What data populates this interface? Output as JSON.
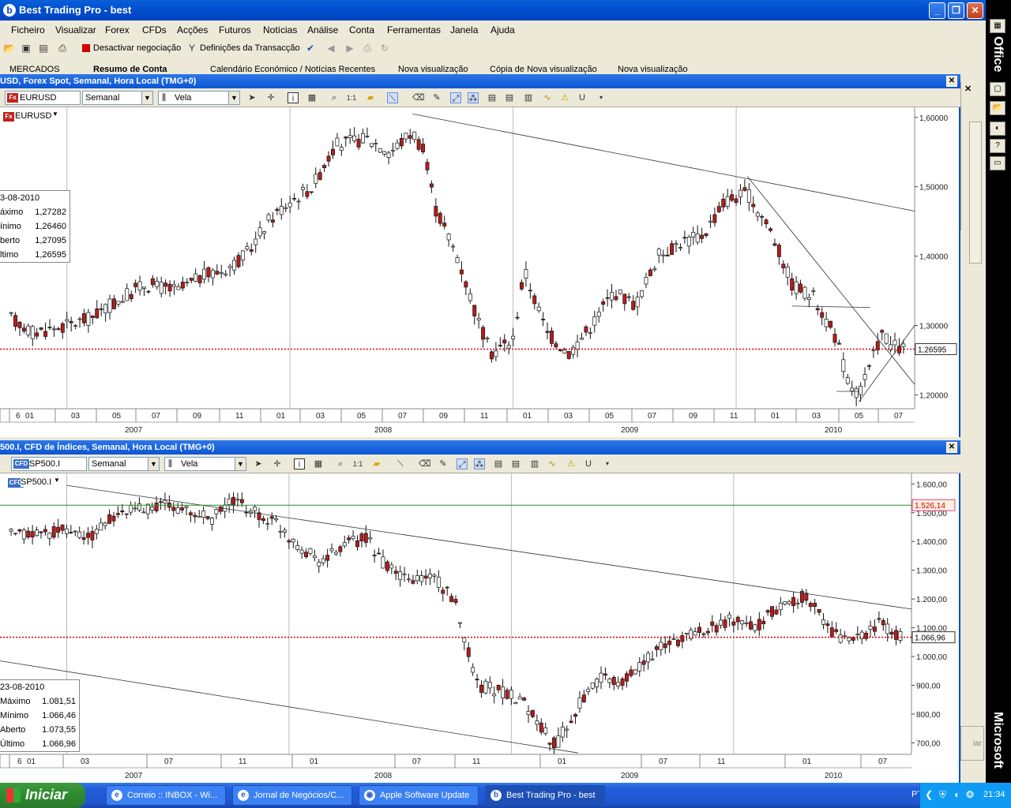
{
  "app": {
    "title": "Best Trading Pro - best"
  },
  "menu": [
    "Ficheiro",
    "Visualizar",
    "Forex",
    "CFDs",
    "Acções",
    "Futuros",
    "Notícias",
    "Análise",
    "Conta",
    "Ferramentas",
    "Janela",
    "Ajuda"
  ],
  "toolbar": {
    "deactivate_label": "Desactivar negociação",
    "settings_label": "Definições da Transacção"
  },
  "tabs": [
    "MERCADOS",
    "Resumo de Conta",
    "Calendário Económico / Notícias Recentes",
    "Nova visualização",
    "Cópia de Nova visualização",
    "Nova visualização"
  ],
  "office": {
    "top_label": "Office",
    "bottom_label": "Microsoft"
  },
  "chart1": {
    "window_title": "USD, Forex Spot, Semanal, Hora Local (TMG+0)",
    "symbol": "EURUSD",
    "symbol_badge": "Fx",
    "period": "Semanal",
    "chart_type": "Vela",
    "legend_label": "EURUSD",
    "info": {
      "date": "3-08-2010",
      "rows": [
        {
          "k": "áximo",
          "v": "1,27282"
        },
        {
          "k": "ínimo",
          "v": "1,26460"
        },
        {
          "k": "berto",
          "v": "1,27095"
        },
        {
          "k": "ltimo",
          "v": "1,26595"
        }
      ]
    },
    "current_price": "1,26595"
  },
  "chart2": {
    "window_title": "500.I, CFD de Índices, Semanal, Hora Local (TMG+0)",
    "symbol": "SP500.I",
    "symbol_badge": "CFD",
    "period": "Semanal",
    "chart_type": "Vela",
    "legend_label": "SP500.I",
    "info": {
      "date": "23-08-2010",
      "rows": [
        {
          "k": "Máximo",
          "v": "1.081,51"
        },
        {
          "k": "Mínimo",
          "v": "1.066,46"
        },
        {
          "k": "Aberto",
          "v": "1.073,55"
        },
        {
          "k": "Último",
          "v": "1.066,96"
        }
      ]
    },
    "current_price": "1.066,96",
    "level_price": "1.526,14",
    "partial_button": "iar"
  },
  "chart_data": [
    {
      "type": "candlestick",
      "series": [
        {
          "name": "EURUSD",
          "values": []
        }
      ],
      "ylim": [
        1.18,
        1.61
      ],
      "y_ticks": [
        "1,60000",
        "1,50000",
        "1,40000",
        "1,30000",
        "1,20000"
      ],
      "x_month_ticks": [
        "6",
        "01",
        "03",
        "05",
        "07",
        "09",
        "11",
        "01",
        "03",
        "05",
        "07",
        "09",
        "11",
        "01",
        "03",
        "05",
        "07",
        "09",
        "11",
        "01",
        "03",
        "05",
        "07"
      ],
      "x_year_ticks": [
        "2007",
        "2008",
        "2009",
        "2010"
      ],
      "x_range": [
        "2006-09",
        "2010-09"
      ],
      "close_path": [
        [
          2006.75,
          1.31
        ],
        [
          2006.85,
          1.29
        ],
        [
          2007.0,
          1.3
        ],
        [
          2007.1,
          1.31
        ],
        [
          2007.2,
          1.33
        ],
        [
          2007.35,
          1.36
        ],
        [
          2007.5,
          1.35
        ],
        [
          2007.6,
          1.37
        ],
        [
          2007.7,
          1.38
        ],
        [
          2007.8,
          1.4
        ],
        [
          2007.9,
          1.45
        ],
        [
          2008.0,
          1.48
        ],
        [
          2008.1,
          1.5
        ],
        [
          2008.2,
          1.56
        ],
        [
          2008.35,
          1.57
        ],
        [
          2008.45,
          1.55
        ],
        [
          2008.55,
          1.58
        ],
        [
          2008.6,
          1.55
        ],
        [
          2008.65,
          1.47
        ],
        [
          2008.75,
          1.4
        ],
        [
          2008.85,
          1.3
        ],
        [
          2008.9,
          1.26
        ],
        [
          2009.0,
          1.28
        ],
        [
          2009.05,
          1.38
        ],
        [
          2009.15,
          1.29
        ],
        [
          2009.25,
          1.26
        ],
        [
          2009.35,
          1.3
        ],
        [
          2009.45,
          1.35
        ],
        [
          2009.55,
          1.33
        ],
        [
          2009.65,
          1.4
        ],
        [
          2009.75,
          1.42
        ],
        [
          2009.85,
          1.43
        ],
        [
          2009.95,
          1.48
        ],
        [
          2010.05,
          1.49
        ],
        [
          2010.15,
          1.44
        ],
        [
          2010.25,
          1.36
        ],
        [
          2010.35,
          1.34
        ],
        [
          2010.45,
          1.28
        ],
        [
          2010.5,
          1.22
        ],
        [
          2010.55,
          1.2
        ],
        [
          2010.6,
          1.24
        ],
        [
          2010.65,
          1.29
        ],
        [
          2010.7,
          1.27
        ],
        [
          2010.75,
          1.26595
        ]
      ],
      "last_close": 1.26595
    },
    {
      "type": "candlestick",
      "series": [
        {
          "name": "SP500.I",
          "values": []
        }
      ],
      "ylim": [
        660,
        1620
      ],
      "y_ticks": [
        "1.600,00",
        "1.500,00",
        "1.400,00",
        "1.300,00",
        "1.200,00",
        "1.100,00",
        "1.000,00",
        "900,00",
        "800,00",
        "700,00"
      ],
      "x_month_ticks": [
        "6",
        "01",
        "03",
        "07",
        "11",
        "01",
        "07",
        "11",
        "01",
        "07",
        "11",
        "01",
        "07"
      ],
      "x_year_ticks": [
        "2007",
        "2008",
        "2009",
        "2010"
      ],
      "x_range": [
        "2006-09",
        "2010-09"
      ],
      "close_path": [
        [
          2006.75,
          1420
        ],
        [
          2006.9,
          1430
        ],
        [
          2007.0,
          1440
        ],
        [
          2007.1,
          1410
        ],
        [
          2007.2,
          1480
        ],
        [
          2007.3,
          1510
        ],
        [
          2007.45,
          1530
        ],
        [
          2007.55,
          1500
        ],
        [
          2007.65,
          1480
        ],
        [
          2007.75,
          1540
        ],
        [
          2007.85,
          1500
        ],
        [
          2007.95,
          1460
        ],
        [
          2008.05,
          1380
        ],
        [
          2008.15,
          1330
        ],
        [
          2008.25,
          1390
        ],
        [
          2008.35,
          1410
        ],
        [
          2008.45,
          1300
        ],
        [
          2008.55,
          1260
        ],
        [
          2008.65,
          1280
        ],
        [
          2008.75,
          1180
        ],
        [
          2008.85,
          900
        ],
        [
          2008.95,
          880
        ],
        [
          2009.05,
          850
        ],
        [
          2009.15,
          740
        ],
        [
          2009.2,
          690
        ],
        [
          2009.3,
          830
        ],
        [
          2009.4,
          920
        ],
        [
          2009.5,
          910
        ],
        [
          2009.6,
          990
        ],
        [
          2009.7,
          1040
        ],
        [
          2009.8,
          1080
        ],
        [
          2009.9,
          1100
        ],
        [
          2010.0,
          1130
        ],
        [
          2010.1,
          1100
        ],
        [
          2010.2,
          1170
        ],
        [
          2010.3,
          1210
        ],
        [
          2010.35,
          1190
        ],
        [
          2010.45,
          1080
        ],
        [
          2010.55,
          1050
        ],
        [
          2010.65,
          1120
        ],
        [
          2010.75,
          1066.96
        ]
      ],
      "last_close": 1066.96,
      "horizontal_level": 1526.14
    }
  ],
  "taskbar": {
    "start": "Iniciar",
    "tasks": [
      "Correio :: INBOX - Wi...",
      "Jornal de Negócios/C...",
      "Apple Software Update",
      "Best Trading Pro - best"
    ],
    "lang": "PT",
    "clock": "21:34"
  },
  "colors": {
    "up": "#ffffff",
    "down": "#b81c1c",
    "price_line": "#cc0000",
    "level_line": "#2a8a2a"
  }
}
